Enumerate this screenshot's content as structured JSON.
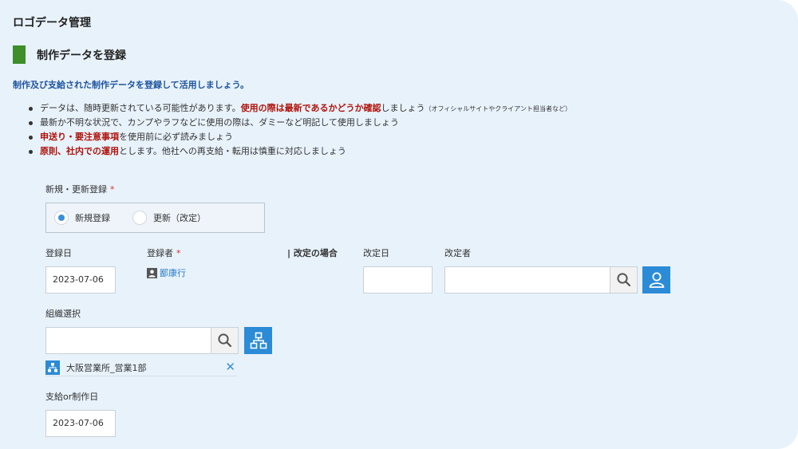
{
  "app": {
    "title": "ロゴデータ管理"
  },
  "section": {
    "title": "制作データを登録"
  },
  "lead": "制作及び支給された制作データを登録して活用しましょう。",
  "notes": {
    "n1": {
      "a": "データは、随時更新されている可能性があります。",
      "b": "使用の際は最新であるかどうか確認",
      "c": "しましょう",
      "d": "（オフィシャルサイトやクライアント担当者など）"
    },
    "n2": {
      "a": "最新か不明な状況で、カンプやラフなどに使用の際は、ダミーなど明記して使用しましょう"
    },
    "n3": {
      "b": "申送り・要注意事項",
      "a": "を使用前に必ず読みましょう"
    },
    "n4": {
      "b": "原則、社内での運用",
      "a": "とします。他社への再支給・転用は慎重に対応しましょう"
    }
  },
  "form": {
    "reg_type": {
      "label": "新規・更新登録",
      "required_mark": "*",
      "options": [
        "新規登録",
        "更新（改定）"
      ],
      "selected": "新規登録"
    },
    "reg_date": {
      "label": "登録日",
      "value": "2023-07-06"
    },
    "registrant": {
      "label": "登録者",
      "required_mark": "*",
      "value": "鄙康行"
    },
    "revision": {
      "heading": "改定の場合",
      "date_label": "改定日",
      "date_value": "",
      "reviser_label": "改定者",
      "reviser_value": ""
    },
    "org": {
      "label": "組織選択",
      "value": "",
      "selected_name": "大阪営業所_営業1部"
    },
    "supply_date": {
      "label": "支給or制作日",
      "value": "2023-07-06"
    }
  },
  "colors": {
    "accent_blue": "#2b8bd6",
    "section_green": "#3e8e2a",
    "warning_red": "#b0120a",
    "required_red": "#d9302c"
  },
  "icons": [
    "search-icon",
    "user-icon",
    "org-chart-icon",
    "person-badge-icon",
    "close-icon",
    "radio-selected-icon",
    "radio-unselected-icon"
  ]
}
